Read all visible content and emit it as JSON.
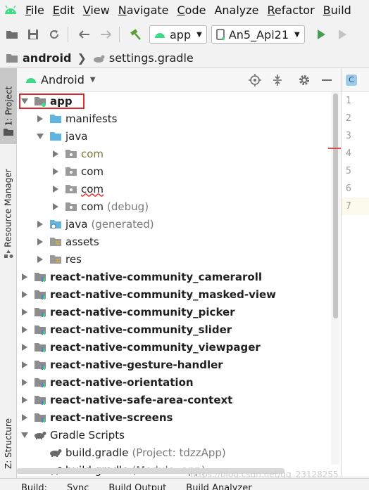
{
  "menu": {
    "items": [
      {
        "label": "File",
        "mnemonic": "F",
        "rest": "ile"
      },
      {
        "label": "Edit",
        "mnemonic": "E",
        "rest": "dit"
      },
      {
        "label": "View",
        "mnemonic": "V",
        "rest": "iew"
      },
      {
        "label": "Navigate",
        "mnemonic": "N",
        "rest": "avigate"
      },
      {
        "label": "Code",
        "mnemonic": "C",
        "rest": "ode"
      },
      {
        "label": "Analyze",
        "mnemonic": "",
        "rest": "Analyze"
      },
      {
        "label": "Refactor",
        "mnemonic": "R",
        "rest": "efactor"
      },
      {
        "label": "Build",
        "mnemonic": "B",
        "rest": "uild"
      }
    ]
  },
  "toolbar": {
    "config_label": "app",
    "device_label": "An5_Api21"
  },
  "breadcrumb": {
    "root": "android",
    "file": "settings.gradle"
  },
  "left_strip": {
    "project_tab": "1: Project",
    "resource_tab": "Resource Manager",
    "structure_tab": "Z: Structure"
  },
  "panel": {
    "view_mode": "Android"
  },
  "tree": [
    {
      "label": "app",
      "suffix": "",
      "style": "bold",
      "indent": 0,
      "expanded": true,
      "icon": "module-icon"
    },
    {
      "label": "manifests",
      "suffix": "",
      "style": "",
      "indent": 1,
      "expanded": false,
      "icon": "folder-icon"
    },
    {
      "label": "java",
      "suffix": "",
      "style": "",
      "indent": 1,
      "expanded": true,
      "icon": "folder-icon"
    },
    {
      "label": "com",
      "suffix": "",
      "style": "olive",
      "indent": 2,
      "expanded": false,
      "icon": "package-icon"
    },
    {
      "label": "com",
      "suffix": "",
      "style": "",
      "indent": 2,
      "expanded": false,
      "icon": "package-icon"
    },
    {
      "label": "com",
      "suffix": "",
      "style": "squiggle",
      "indent": 2,
      "expanded": false,
      "icon": "package-icon"
    },
    {
      "label": "com",
      "suffix": "(debug)",
      "style": "",
      "indent": 2,
      "expanded": false,
      "icon": "package-icon"
    },
    {
      "label": "java",
      "suffix": "(generated)",
      "style": "",
      "indent": 1,
      "expanded": false,
      "icon": "generated-folder-icon"
    },
    {
      "label": "assets",
      "suffix": "",
      "style": "",
      "indent": 1,
      "expanded": false,
      "icon": "resource-folder-icon"
    },
    {
      "label": "res",
      "suffix": "",
      "style": "",
      "indent": 1,
      "expanded": false,
      "icon": "resource-folder-icon"
    },
    {
      "label": "react-native-community_cameraroll",
      "suffix": "",
      "style": "bold",
      "indent": 0,
      "expanded": false,
      "icon": "library-module-icon"
    },
    {
      "label": "react-native-community_masked-view",
      "suffix": "",
      "style": "bold",
      "indent": 0,
      "expanded": false,
      "icon": "library-module-icon"
    },
    {
      "label": "react-native-community_picker",
      "suffix": "",
      "style": "bold",
      "indent": 0,
      "expanded": false,
      "icon": "library-module-icon"
    },
    {
      "label": "react-native-community_slider",
      "suffix": "",
      "style": "bold",
      "indent": 0,
      "expanded": false,
      "icon": "library-module-icon"
    },
    {
      "label": "react-native-community_viewpager",
      "suffix": "",
      "style": "bold",
      "indent": 0,
      "expanded": false,
      "icon": "library-module-icon"
    },
    {
      "label": "react-native-gesture-handler",
      "suffix": "",
      "style": "bold",
      "indent": 0,
      "expanded": false,
      "icon": "library-module-icon"
    },
    {
      "label": "react-native-orientation",
      "suffix": "",
      "style": "bold",
      "indent": 0,
      "expanded": false,
      "icon": "library-module-icon"
    },
    {
      "label": "react-native-safe-area-context",
      "suffix": "",
      "style": "bold",
      "indent": 0,
      "expanded": false,
      "icon": "library-module-icon"
    },
    {
      "label": "react-native-screens",
      "suffix": "",
      "style": "bold",
      "indent": 0,
      "expanded": false,
      "icon": "library-module-icon"
    },
    {
      "label": "Gradle Scripts",
      "suffix": "",
      "style": "",
      "indent": 0,
      "expanded": true,
      "icon": "gradle-icon"
    },
    {
      "label": "build.gradle",
      "suffix": "(Project: tdzzApp)",
      "style": "",
      "indent": 1,
      "expanded": null,
      "icon": "gradle-icon"
    },
    {
      "label": "build.gradle",
      "suffix": "(Module: app)",
      "style": "",
      "indent": 1,
      "expanded": null,
      "icon": "gradle-icon"
    }
  ],
  "editor": {
    "tab_badge": "C",
    "line_numbers": [
      "1",
      "2",
      "3",
      "4",
      "5",
      "6",
      "7"
    ],
    "current_line": "7"
  },
  "bottom_tabs": [
    "Build:",
    "Sync",
    "Build Output",
    "Build Analyzer"
  ],
  "watermark": "https://blog.csdn.net/qq_23128255",
  "colors": {
    "android_green": "#3ddc84",
    "run_green": "#499c54",
    "hammer_green": "#5a9e3a",
    "folder_blue": "#5fb4e0",
    "selection_red": "#e0282e"
  }
}
